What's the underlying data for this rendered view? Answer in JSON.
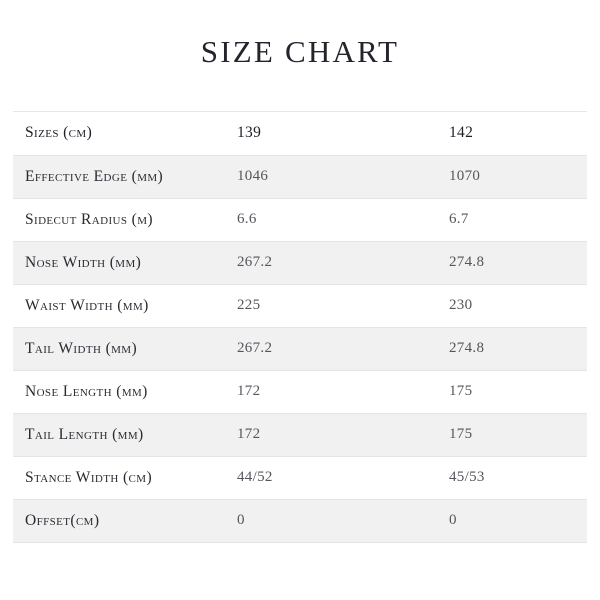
{
  "page": {
    "title": "SIZE CHART",
    "background_color": "#ffffff",
    "shaded_row_color": "#f1f1f1",
    "row_divider_color": "#e4e4e4",
    "label_text_color": "#2a2a32",
    "value_text_color": "#55555c"
  },
  "table": {
    "columns": [
      {
        "key": "label",
        "header": "Sizes (cm)"
      },
      {
        "key": "size_139",
        "header": "139"
      },
      {
        "key": "size_142",
        "header": "142"
      }
    ],
    "rows": [
      {
        "label": "Effective Edge (mm)",
        "size_139": "1046",
        "size_142": "1070",
        "shaded": true
      },
      {
        "label": "Sidecut Radius (m)",
        "size_139": "6.6",
        "size_142": "6.7",
        "shaded": false
      },
      {
        "label": "Nose Width (mm)",
        "size_139": "267.2",
        "size_142": "274.8",
        "shaded": true
      },
      {
        "label": "Waist Width (mm)",
        "size_139": "225",
        "size_142": "230",
        "shaded": false
      },
      {
        "label": "Tail Width (mm)",
        "size_139": "267.2",
        "size_142": "274.8",
        "shaded": true
      },
      {
        "label": "Nose Length (mm)",
        "size_139": "172",
        "size_142": "175",
        "shaded": false
      },
      {
        "label": "Tail Length (mm)",
        "size_139": "172",
        "size_142": "175",
        "shaded": true
      },
      {
        "label": "Stance Width (cm)",
        "size_139": "44/52",
        "size_142": "45/53",
        "shaded": false
      },
      {
        "label": "Offset(cm)",
        "size_139": "0",
        "size_142": "0",
        "shaded": true
      }
    ]
  }
}
